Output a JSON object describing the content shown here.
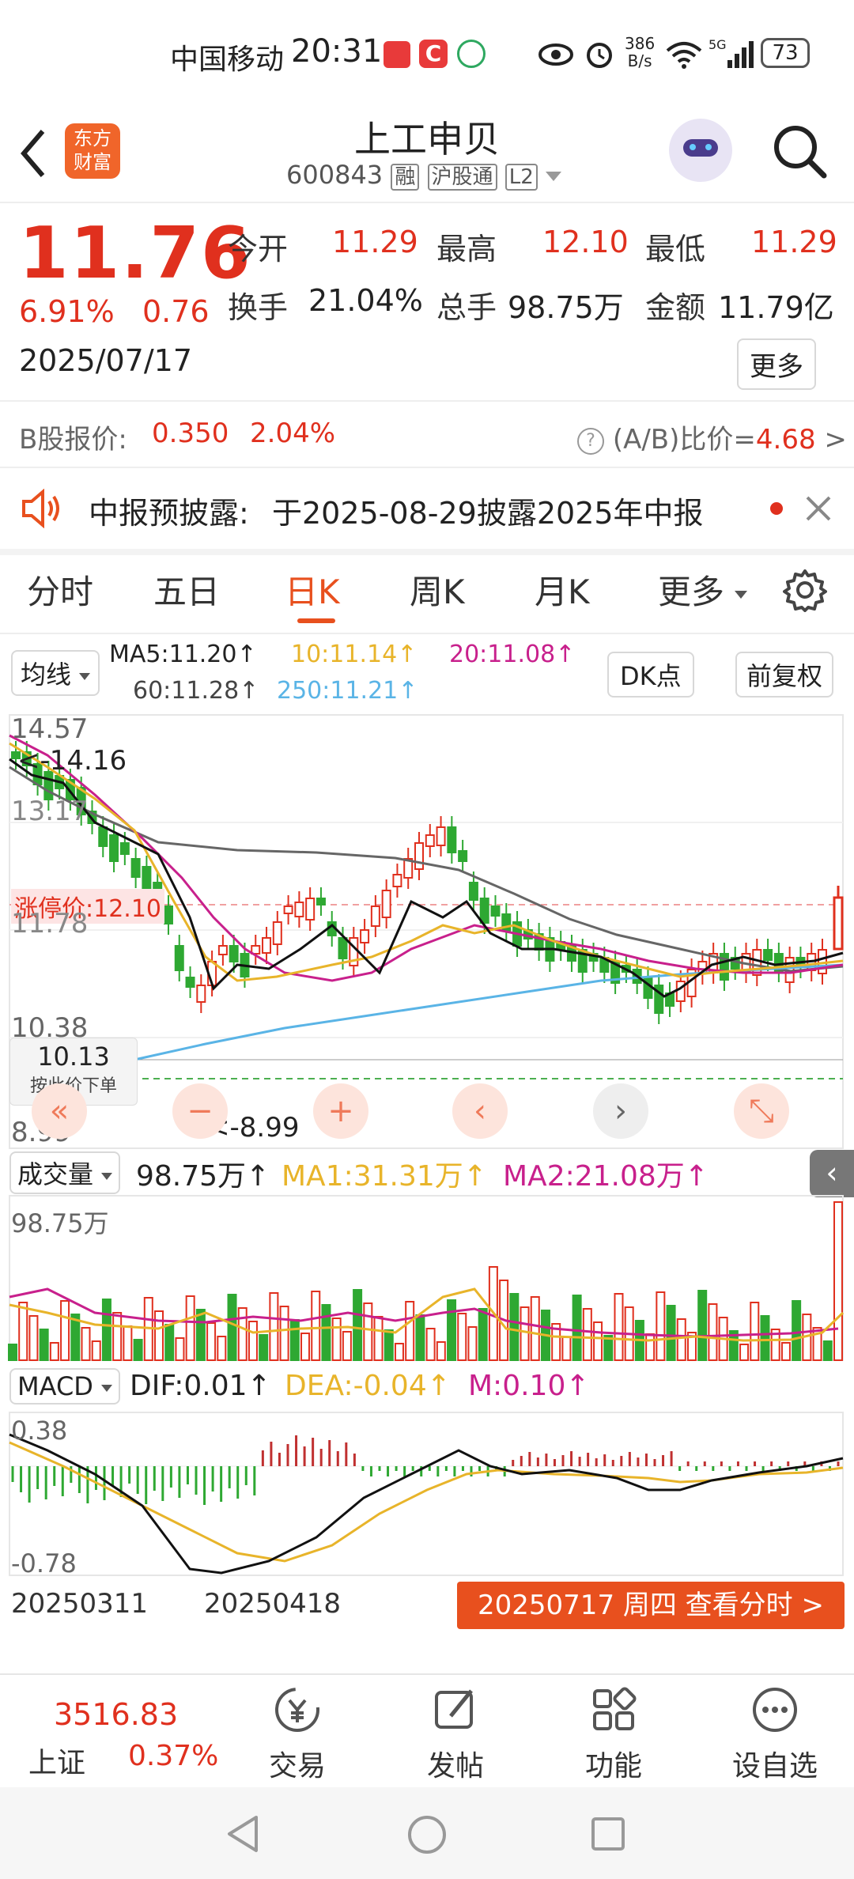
{
  "status_bar": {
    "carrier": "中国移动",
    "time": "20:31",
    "speed_value": "386",
    "speed_unit": "B/s",
    "battery": "73"
  },
  "header": {
    "logo_line1": "东方",
    "logo_line2": "财富",
    "stock_name": "上工申贝",
    "stock_code": "600843",
    "tag_margin": "融",
    "tag_connect": "沪股通",
    "tag_level": "L2"
  },
  "quote": {
    "price": "11.76",
    "change_pct": "6.91%",
    "change_amt": "0.76",
    "date": "2025/07/17",
    "open_label": "今开",
    "open_value": "11.29",
    "high_label": "最高",
    "high_value": "12.10",
    "low_label": "最低",
    "low_value": "11.29",
    "turnover_label": "换手",
    "turnover_value": "21.04%",
    "volume_label": "总手",
    "volume_value": "98.75万",
    "amount_label": "金额",
    "amount_value": "11.79亿",
    "more_button": "更多"
  },
  "b_share": {
    "label": "B股报价:",
    "price": "0.350",
    "pct": "2.04%",
    "ratio_label": "(A/B)比价=",
    "ratio_value": "4.68",
    "arrow": ">"
  },
  "notice": {
    "title": "中报预披露:",
    "text": "于2025-08-29披露2025年中报"
  },
  "tabs": [
    {
      "label": "分时"
    },
    {
      "label": "五日"
    },
    {
      "label": "日K"
    },
    {
      "label": "周K"
    },
    {
      "label": "月K"
    },
    {
      "label": "更多"
    }
  ],
  "ma_bar": {
    "selector": "均线",
    "ma5": "MA5:11.20↑",
    "ma10": "10:11.14↑",
    "ma20": "20:11.08↑",
    "ma60": "60:11.28↑",
    "ma250": "250:11.21↑",
    "dk_button": "DK点",
    "fq_button": "前复权"
  },
  "kline": {
    "y_top": "14.57",
    "y_mid1": "13.17",
    "y_mid2": "11.78",
    "y_low": "10.38",
    "y_bottom": "8.99",
    "high_marker": "<-14.16",
    "low_marker": "<-8.99",
    "limit_label": "涨停价:12.10",
    "order_price": "10.13",
    "order_hint": "按此价下单",
    "y_range": [
      8.99,
      14.57
    ]
  },
  "volume": {
    "selector": "成交量",
    "value": "98.75万↑",
    "ma1": "MA1:31.31万↑",
    "ma2": "MA2:21.08万↑",
    "axis_top": "98.75万"
  },
  "macd": {
    "selector": "MACD",
    "dif": "DIF:0.01↑",
    "dea": "DEA:-0.04↑",
    "m": "M:0.10↑",
    "axis_top": "0.38",
    "axis_bottom": "-0.78"
  },
  "x_axis": {
    "start": "20250311",
    "mid": "20250418"
  },
  "view_intraday_button": "20250717 周四 查看分时 >",
  "bottom_nav": {
    "index_value": "3516.83",
    "index_name": "上证",
    "index_pct": "0.37%",
    "trade": "交易",
    "post": "发帖",
    "function": "功能",
    "watchlist": "设自选"
  },
  "colors": {
    "up": "#e0301e",
    "down": "#2ea832",
    "accent": "#e8501e",
    "ma5": "#000000",
    "ma10": "#e8b42a",
    "ma20": "#c8208c",
    "ma60": "#666666",
    "ma250": "#5ab4e6"
  },
  "chart_data": [
    {
      "type": "candlestick",
      "title": "日K",
      "y_range": [
        8.99,
        14.57
      ],
      "x_labels": [
        "20250311",
        "20250418"
      ],
      "last_close": 11.76,
      "period_high": 14.16,
      "period_low": 8.99,
      "limit_up_price": 12.1,
      "series": [
        {
          "name": "MA5",
          "last": 11.2
        },
        {
          "name": "MA10",
          "last": 11.14
        },
        {
          "name": "MA20",
          "last": 11.08
        },
        {
          "name": "MA60",
          "last": 11.28
        },
        {
          "name": "MA250",
          "last": 11.21
        }
      ]
    },
    {
      "type": "bar",
      "title": "成交量",
      "last_value": "98.75万",
      "series": [
        {
          "name": "MA1",
          "last": "31.31万"
        },
        {
          "name": "MA2",
          "last": "21.08万"
        }
      ]
    },
    {
      "type": "bar",
      "title": "MACD",
      "y_range": [
        -0.78,
        0.38
      ],
      "series": [
        {
          "name": "DIF",
          "last": 0.01
        },
        {
          "name": "DEA",
          "last": -0.04
        },
        {
          "name": "M",
          "last": 0.1
        }
      ]
    }
  ]
}
